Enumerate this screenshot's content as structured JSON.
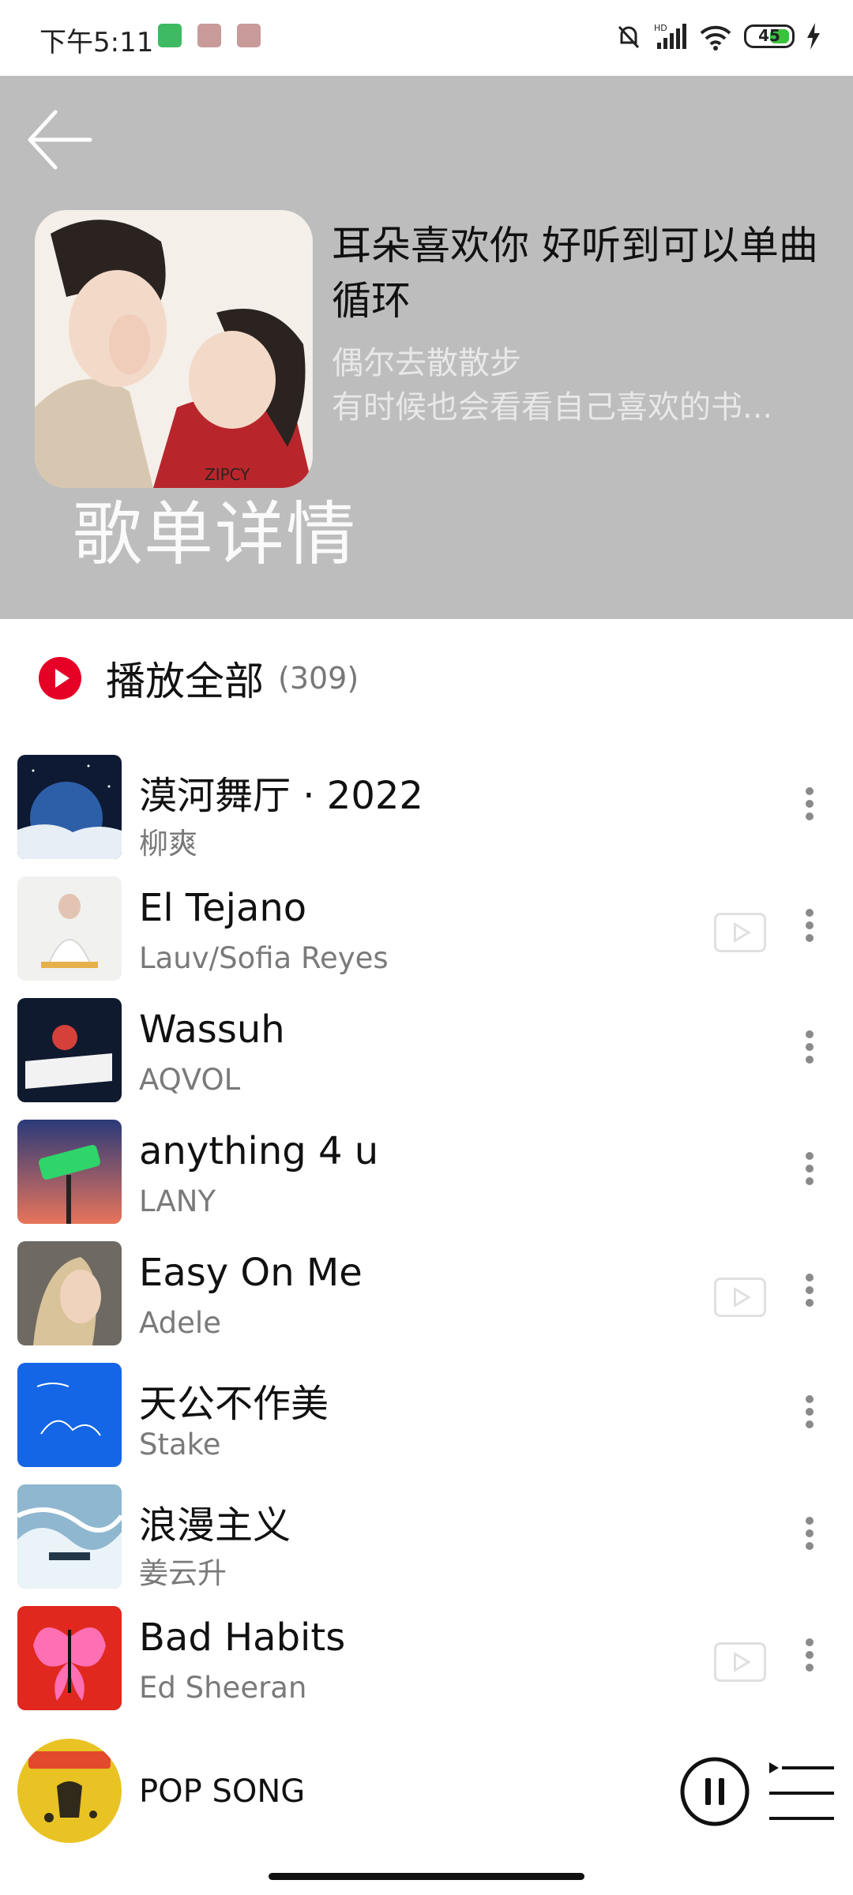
{
  "status_bar": {
    "time": "下午5:11",
    "battery": "45",
    "icons": [
      "android-app-icon",
      "download-icon",
      "download-icon",
      "mute-bell-icon",
      "hd-signal-icon",
      "wifi-icon",
      "battery-icon",
      "charging-icon"
    ]
  },
  "header": {
    "back_icon": "back-arrow-icon",
    "playlist_title": "耳朵喜欢你 好听到可以单曲循环",
    "description_line1": "偶尔去散散步",
    "description_line2": "有时候也会看看自己喜欢的书...",
    "page_label": "歌单详情",
    "background_color": "#bdbdbd"
  },
  "play_all": {
    "label": "播放全部",
    "count": "(309)",
    "icon": "play-circle-icon",
    "icon_color": "#e60026"
  },
  "songs": [
    {
      "title": "漠河舞厅 · 2022",
      "artist": "柳爽",
      "has_mv": false
    },
    {
      "title": "El Tejano",
      "artist": "Lauv/Sofia Reyes",
      "has_mv": true
    },
    {
      "title": "Wassuh",
      "artist": "AQVOL",
      "has_mv": false
    },
    {
      "title": "anything 4 u",
      "artist": "LANY",
      "has_mv": false
    },
    {
      "title": "Easy On Me",
      "artist": "Adele",
      "has_mv": true
    },
    {
      "title": "天公不作美",
      "artist": "Stake",
      "has_mv": false
    },
    {
      "title": "浪漫主义",
      "artist": "姜云升",
      "has_mv": false
    },
    {
      "title": "Bad Habits",
      "artist": "Ed Sheeran",
      "has_mv": true
    }
  ],
  "player": {
    "title": "POP SONG",
    "pause_icon": "pause-icon",
    "queue_icon": "playlist-queue-icon"
  }
}
